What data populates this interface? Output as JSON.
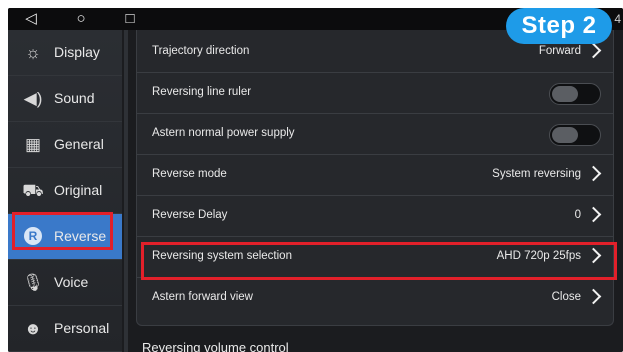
{
  "statusbar": {
    "back_icon": "◁",
    "home_icon": "○",
    "recent_icon": "□",
    "clock_fragment": "4"
  },
  "step_badge": "Step 2",
  "sidebar": {
    "items": [
      {
        "label": "Display",
        "icon": "sun-icon"
      },
      {
        "label": "Sound",
        "icon": "speaker-icon"
      },
      {
        "label": "General",
        "icon": "grid-icon"
      },
      {
        "label": "Original",
        "icon": "car-icon"
      },
      {
        "label": "Reverse",
        "icon": "r-circle-icon",
        "active": true
      },
      {
        "label": "Voice",
        "icon": "microphone-icon"
      },
      {
        "label": "Personal",
        "icon": "person-icon"
      }
    ]
  },
  "settings": {
    "rows": [
      {
        "label": "Trajectory direction",
        "value": "Forward"
      },
      {
        "label": "Reversing line ruler",
        "toggle": false
      },
      {
        "label": "Astern normal power supply",
        "toggle": false
      },
      {
        "label": "Reverse mode",
        "value": "System reversing"
      },
      {
        "label": "Reverse Delay",
        "value": "0"
      },
      {
        "label": "Reversing system selection",
        "value": "AHD 720p 25fps"
      },
      {
        "label": "Astern forward view",
        "value": "Close"
      }
    ],
    "section_heading": "Reversing volume control"
  },
  "colors": {
    "accent": "#3a79c9",
    "badge": "#1e9be8",
    "highlight": "#e2202a",
    "background": "#1b1c1f"
  }
}
